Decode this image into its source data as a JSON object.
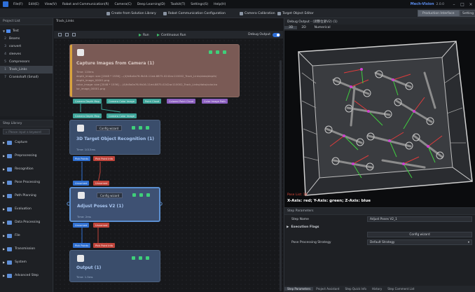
{
  "menubar": {
    "items": [
      "File(F)",
      "Edit(E)",
      "View(V)",
      "Robot and Communication(R)",
      "Camera(C)",
      "Deep Learning(D)",
      "Toolkit(T)",
      "Settings(S)",
      "Help(H)"
    ],
    "brand": "Mech-Vision",
    "version": "2.0.0"
  },
  "toolbar": {
    "create_label": "Create from Solution Library",
    "robot_comm_label": "Robot Communication Configuration",
    "camera_calib_label": "Camera Calibration",
    "target_editor_label": "Target Object Editor",
    "production_label": "Production Interface",
    "settings_label": "Setting"
  },
  "project_list": {
    "title": "Project List",
    "root": "Test",
    "items": [
      {
        "num": "2",
        "name": "Beams"
      },
      {
        "num": "3",
        "name": "convert"
      },
      {
        "num": "4",
        "name": "sleeves"
      },
      {
        "num": "5",
        "name": "Compressors"
      },
      {
        "num": "1",
        "name": "Track_Links"
      },
      {
        "num": "7",
        "name": "Crankshaft (Small)"
      }
    ]
  },
  "step_library": {
    "title": "Step Library",
    "search_placeholder": "Please input a keyword",
    "items": [
      "Capture",
      "Preprocessing",
      "Recognition",
      "Pose Processing",
      "Path Planning",
      "Evaluation",
      "Data Processing",
      "File",
      "Transmission",
      "System",
      "Advanced Step"
    ]
  },
  "graph": {
    "tab": "Track_Links",
    "run_label": "Run",
    "continuous_label": "Continuous Run",
    "debug_output_label": "Debug Output",
    "nodes": {
      "capture": {
        "title": "Capture Images from Camera (1)",
        "time": "Time: 120ms",
        "info1": "depth_image: size [2048 * 1536] ...(4)fc8a0a76-9b16-11ed-8875-0242ac110002_Track_Links/data/depth/",
        "info2": "depth_image_00001.png",
        "info3": "color_image: size [2048 * 1536] ...(4)fc8a0a76-9b16-11ed-8875-0242ac110002_Track_Links/data/color/co",
        "info4": "lor_image_00001.png"
      },
      "recognition": {
        "title": "3D Target Object Recognition (1)",
        "config": "Config wizard",
        "time": "Time: 1013ms"
      },
      "adjust": {
        "title": "Adjust Poses V2 (1)",
        "config": "Config wizard",
        "time": "Time: 2ms"
      },
      "output": {
        "title": "Output (1)",
        "time": "Time: 1.5ms"
      }
    },
    "ports": {
      "capture_out": [
        "Camera Depth Map",
        "Camera Color Image",
        "Point Cloud",
        "Colored Point Cloud",
        "Color Image Path"
      ],
      "recog_in": [
        "Camera Depth Map",
        "Camera Color Image"
      ],
      "recog_out": [
        "Pick Points",
        "Pick Point Info"
      ],
      "adjust_in": [
        "Unnamed",
        "Unnamed"
      ],
      "adjust_out": [
        "Unnamed",
        "Unnamed"
      ],
      "output_in": [
        "Pick Points",
        "Pick Point Info"
      ]
    }
  },
  "debug": {
    "title": "Debug Output - (调整位姿V2) (1)",
    "tabs": [
      "3D",
      "2D",
      "Numerical"
    ],
    "pose_count": "Pose List: 16",
    "axis_info": "X-Axis: red; Y-Axis: green; Z-Axis: blue"
  },
  "params": {
    "title": "Step Parameters",
    "step_name_label": "Step Name",
    "step_name_value": "Adjust Poses V2_1",
    "exec_flags": "Execution Flags",
    "config_wizard": "Config wizard",
    "strategy_label": "Pose Processing Strategy",
    "strategy_value": "Default Strategy",
    "bottom_tabs": [
      "Step Parameters",
      "Project Assistant",
      "Step Quick Info",
      "History",
      "Step Comment List"
    ]
  },
  "colors": {
    "accent": "#2e6fd8",
    "capture_node": "#7a5a55",
    "step_node": "#3a4d6b",
    "port_teal": "#3fa59a",
    "port_red": "#c0443b"
  }
}
